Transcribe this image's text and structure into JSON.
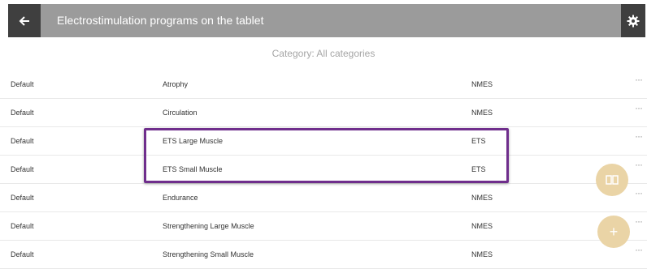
{
  "header": {
    "title": "Electrostimulation programs on the tablet",
    "back_icon": "arrow-left-icon",
    "settings_icon": "gear-icon"
  },
  "category_label": "Category: All categories",
  "rows": [
    {
      "owner": "Default",
      "name": "Atrophy",
      "category": "NMES"
    },
    {
      "owner": "Default",
      "name": "Circulation",
      "category": "NMES"
    },
    {
      "owner": "Default",
      "name": "ETS Large Muscle",
      "category": "ETS"
    },
    {
      "owner": "Default",
      "name": "ETS Small Muscle",
      "category": "ETS"
    },
    {
      "owner": "Default",
      "name": "Endurance",
      "category": "NMES"
    },
    {
      "owner": "Default",
      "name": "Strengthening Large Muscle",
      "category": "NMES"
    },
    {
      "owner": "Default",
      "name": "Strengthening Small Muscle",
      "category": "NMES"
    }
  ],
  "more_label": "···",
  "fab": {
    "compare_icon": "compare-icon",
    "add_label": "+"
  },
  "colors": {
    "appbar": "#9b9b9b",
    "appbar_buttons": "#3f3f3f",
    "highlight": "#6f2e8c",
    "fab": "#ead4a6"
  }
}
